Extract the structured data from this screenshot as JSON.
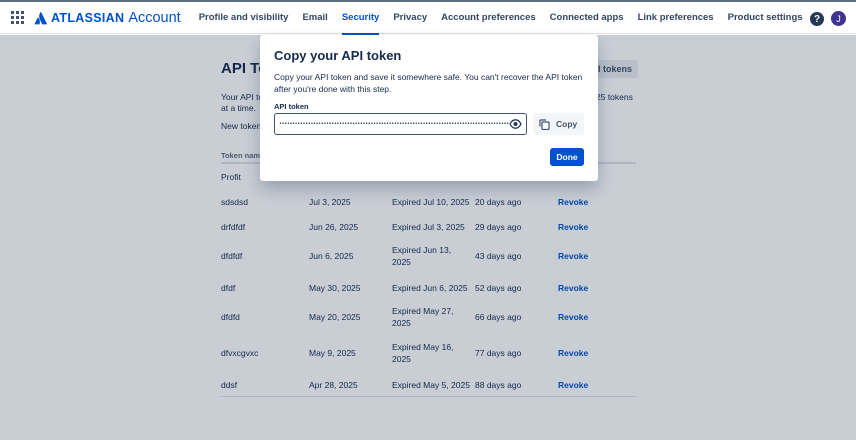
{
  "nav": {
    "brand_name": "ATLASSIAN",
    "brand_sub": "Account",
    "links": [
      {
        "label": "Profile and visibility"
      },
      {
        "label": "Email"
      },
      {
        "label": "Security",
        "active": true
      },
      {
        "label": "Privacy"
      },
      {
        "label": "Account preferences"
      },
      {
        "label": "Connected apps"
      },
      {
        "label": "Link preferences"
      },
      {
        "label": "Product settings"
      }
    ],
    "help_label": "?",
    "avatar_initial": "J"
  },
  "page": {
    "title": "API To",
    "create_button": "PI tokens",
    "intro_line1": "Your API to",
    "intro_line2": "at a time.",
    "intro_right": "25 tokens",
    "new_token_label": "New token"
  },
  "table": {
    "headers": {
      "name": "Token name"
    },
    "rows": [
      {
        "name": "Profit",
        "created": "",
        "expires": "",
        "last_used": "",
        "action": ""
      },
      {
        "name": "sdsdsd",
        "created": "Jul 3, 2025",
        "expires": "Expired Jul 10, 2025",
        "last_used": "20 days ago",
        "action": "Revoke"
      },
      {
        "name": "drfdfdf",
        "created": "Jun 26, 2025",
        "expires": "Expired Jul 3, 2025",
        "last_used": "29 days ago",
        "action": "Revoke"
      },
      {
        "name": "dfdfdf",
        "created": "Jun 6, 2025",
        "expires": "Expired Jun 13, 2025",
        "last_used": "43 days ago",
        "action": "Revoke"
      },
      {
        "name": "dfdf",
        "created": "May 30, 2025",
        "expires": "Expired Jun 6, 2025",
        "last_used": "52 days ago",
        "action": "Revoke"
      },
      {
        "name": "dfdfd",
        "created": "May 20, 2025",
        "expires": "Expired May 27, 2025",
        "last_used": "66 days ago",
        "action": "Revoke"
      },
      {
        "name": "dfvxcgvxc",
        "created": "May 9, 2025",
        "expires": "Expired May 16, 2025",
        "last_used": "77 days ago",
        "action": "Revoke"
      },
      {
        "name": "ddsf",
        "created": "Apr 28, 2025",
        "expires": "Expired May 5, 2025",
        "last_used": "88 days ago",
        "action": "Revoke"
      }
    ]
  },
  "modal": {
    "title": "Copy your API token",
    "description": "Copy your API token and save it somewhere safe. You can't recover the API token after you're done with this step.",
    "field_label": "API token",
    "token_value": "••••••••••••••••••••••••••••••••••••••••••••••••••••••••••••••••••••••••••••••••••••••••••••••••••••••••••",
    "copy_label": "Copy",
    "done_label": "Done"
  },
  "colors": {
    "brand": "#0052cc",
    "text": "#172b4d",
    "overlay": "rgba(9, 30, 66, 0.22)"
  }
}
